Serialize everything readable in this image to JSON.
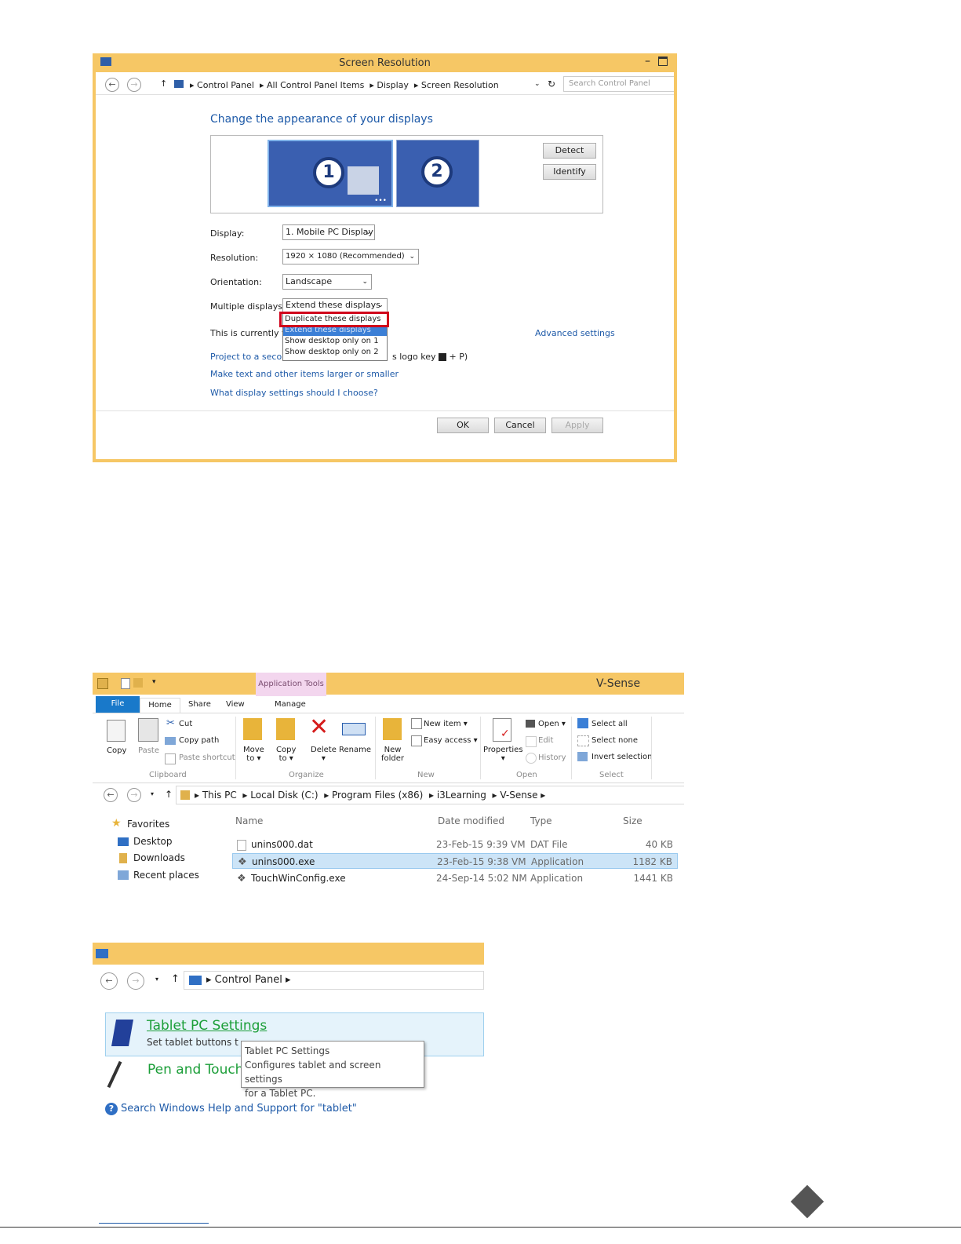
{
  "screen_resolution": {
    "title": "Screen Resolution",
    "breadcrumb": [
      "Control Panel",
      "All Control Panel Items",
      "Display",
      "Screen Resolution"
    ],
    "search_placeholder": "Search Control Panel",
    "heading": "Change the appearance of your displays",
    "monitor_1": "1",
    "monitor_2": "2",
    "detect": "Detect",
    "identify": "Identify",
    "display_label": "Display:",
    "display_value": "1. Mobile PC Display",
    "resolution_label": "Resolution:",
    "resolution_value": "1920 × 1080 (Recommended)",
    "orientation_label": "Orientation:",
    "orientation_value": "Landscape",
    "multiple_label": "Multiple displays:",
    "multiple_value": "Extend these displays",
    "dropdown_options": [
      "Duplicate these displays",
      "Extend these displays",
      "Show desktop only on 1",
      "Show desktop only on 2"
    ],
    "currently_text": "This is currently you",
    "advanced_settings": "Advanced settings",
    "project_link": "Project to a second",
    "project_suffix_1": "s logo key",
    "project_suffix_2": "+ P)",
    "make_text_link": "Make text and other items larger or smaller",
    "what_settings_link": "What display settings should I choose?",
    "ok": "OK",
    "cancel": "Cancel",
    "apply": "Apply"
  },
  "explorer": {
    "context_tab": "Application Tools",
    "title": "V-Sense",
    "tabs": [
      "File",
      "Home",
      "Share",
      "View",
      "Manage"
    ],
    "clipboard": {
      "copy": "Copy",
      "paste": "Paste",
      "cut": "Cut",
      "copy_path": "Copy path",
      "paste_shortcut": "Paste shortcut",
      "group": "Clipboard"
    },
    "organize": {
      "move_to_1": "Move",
      "move_to_2": "to ▾",
      "copy_to_1": "Copy",
      "copy_to_2": "to ▾",
      "delete_1": "Delete",
      "delete_2": "▾",
      "rename": "Rename",
      "group": "Organize"
    },
    "new": {
      "new_folder_1": "New",
      "new_folder_2": "folder",
      "new_item": "New item ▾",
      "easy_access": "Easy access ▾",
      "group": "New"
    },
    "open": {
      "properties_1": "Properties",
      "properties_2": "▾",
      "open": "Open ▾",
      "edit": "Edit",
      "history": "History",
      "group": "Open"
    },
    "select": {
      "select_all": "Select all",
      "select_none": "Select none",
      "invert": "Invert selection",
      "group": "Select"
    },
    "path": [
      "This PC",
      "Local Disk (C:)",
      "Program Files (x86)",
      "i3Learning",
      "V-Sense"
    ],
    "nav": [
      "Favorites",
      "Desktop",
      "Downloads",
      "Recent places"
    ],
    "columns": [
      "Name",
      "Date modified",
      "Type",
      "Size"
    ],
    "files": [
      {
        "name": "unins000.dat",
        "date": "23-Feb-15 9:39 VM",
        "type": "DAT File",
        "size": "40 KB"
      },
      {
        "name": "unins000.exe",
        "date": "23-Feb-15 9:38 VM",
        "type": "Application",
        "size": "1182 KB"
      },
      {
        "name": "TouchWinConfig.exe",
        "date": "24-Sep-14 5:02 NM",
        "type": "Application",
        "size": "1441 KB"
      }
    ]
  },
  "control_panel": {
    "breadcrumb": "Control Panel",
    "tablet_title": "Tablet PC Settings",
    "tablet_desc": "Set tablet buttons t",
    "pen_title": "Pen and Touch",
    "tooltip": [
      "Tablet PC Settings",
      "Configures tablet and screen settings",
      "for a Tablet PC."
    ],
    "search_help": "Search Windows Help and Support for \"tablet\""
  },
  "colors": {
    "title_bar": "#f6c765",
    "link": "#1e5aa8",
    "selection": "#cce4f7",
    "highlight_box": "#d0021b"
  }
}
